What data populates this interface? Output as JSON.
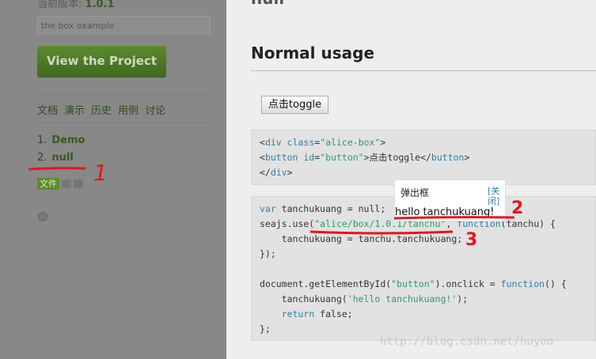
{
  "sidebar": {
    "version_label": "当前版本:",
    "version_value": "1.0.1",
    "description": "the box example",
    "view_project_button": "View the Project",
    "nav": [
      "文档",
      "演示",
      "历史",
      "用例",
      "讨论"
    ],
    "links": [
      {
        "num": "1.",
        "label": "Demo"
      },
      {
        "num": "2.",
        "label": "null"
      }
    ],
    "tag_file": "文件"
  },
  "main": {
    "top_heading": "null",
    "section_title": "Normal usage",
    "toggle_button": "点击toggle",
    "popup": {
      "title": "弹出框",
      "close": "[关闭]",
      "body": "hello tanchukuang!"
    },
    "watermark": "http://blog.csdn.net/huyoo"
  },
  "annotations": {
    "labels": [
      "1",
      "2",
      "3"
    ],
    "color": "#e8141c"
  },
  "colors": {
    "sidebar_bg": "#888888",
    "link_green": "#3a5a1f",
    "button_green": "#4f7a26",
    "code_keyword": "#2e7fa8",
    "code_string": "#2a9a6b"
  }
}
